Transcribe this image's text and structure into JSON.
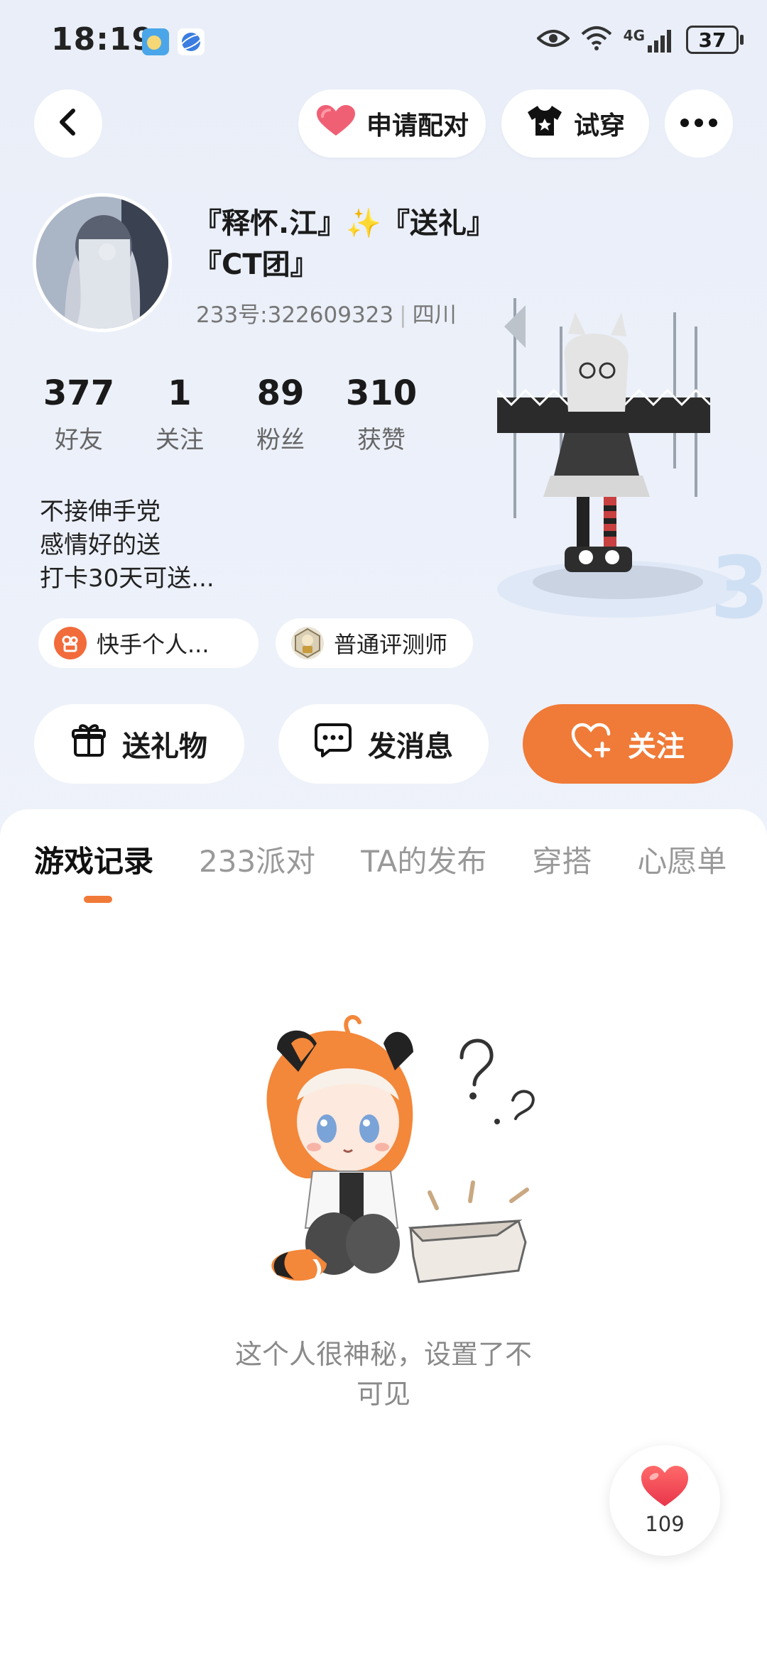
{
  "status_bar": {
    "time": "18:19",
    "network": "4G",
    "battery": "37"
  },
  "top_nav": {
    "match_label": "申请配对",
    "try_on_label": "试穿"
  },
  "profile": {
    "name_line1": "『释怀.江』✨『送礼』",
    "name_line2": "『CT团』",
    "id_text": "233号:322609323",
    "location": "四川",
    "stats": [
      {
        "value": "377",
        "label": "好友"
      },
      {
        "value": "1",
        "label": "关注"
      },
      {
        "value": "89",
        "label": "粉丝"
      },
      {
        "value": "310",
        "label": "获赞"
      }
    ],
    "bio_lines": [
      "不接伸手党",
      "感情好的送",
      "打卡30天可送..."
    ],
    "tags": [
      {
        "label": "快手个人...",
        "icon": "kuaishou-icon"
      },
      {
        "label": "普通评测师",
        "icon": "reviewer-badge-icon"
      }
    ]
  },
  "actions": {
    "gift": "送礼物",
    "message": "发消息",
    "follow": "关注"
  },
  "tabs": [
    "游戏记录",
    "233派对",
    "TA的发布",
    "穿搭",
    "心愿单"
  ],
  "active_tab": 0,
  "empty_state": {
    "line1": "这个人很神秘，设置了不",
    "line2": "可见"
  },
  "like": {
    "count": "109"
  },
  "colors": {
    "accent": "#f07a37",
    "heart": "#f05a5a"
  }
}
